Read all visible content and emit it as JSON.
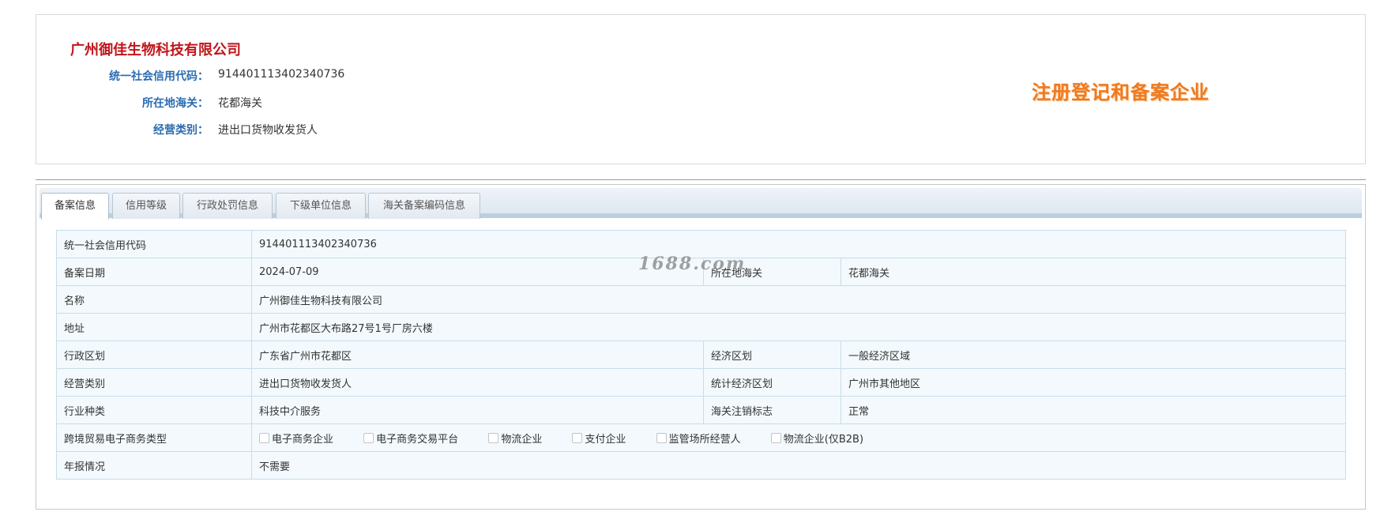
{
  "header": {
    "company_name": "广州御佳生物科技有限公司",
    "rows": [
      {
        "label": "统一社会信用代码：",
        "value": "914401113402340736"
      },
      {
        "label": "所在地海关：",
        "value": "花都海关"
      },
      {
        "label": "经营类别：",
        "value": "进出口货物收发货人"
      }
    ],
    "badge": "注册登记和备案企业"
  },
  "tabs": [
    {
      "label": "备案信息",
      "active": true
    },
    {
      "label": "信用等级",
      "active": false
    },
    {
      "label": "行政处罚信息",
      "active": false
    },
    {
      "label": "下级单位信息",
      "active": false
    },
    {
      "label": "海关备案编码信息",
      "active": false
    }
  ],
  "details": {
    "credit_code": {
      "label": "统一社会信用代码",
      "value": "914401113402340736"
    },
    "record_date": {
      "label": "备案日期",
      "value": "2024-07-09"
    },
    "customs": {
      "label": "所在地海关",
      "value": "花都海关"
    },
    "name": {
      "label": "名称",
      "value": "广州御佳生物科技有限公司"
    },
    "address": {
      "label": "地址",
      "value": "广州市花都区大布路27号1号厂房六楼"
    },
    "admin_region": {
      "label": "行政区划",
      "value": "广东省广州市花都区"
    },
    "econ_region": {
      "label": "经济区划",
      "value": "一般经济区域"
    },
    "business_type": {
      "label": "经营类别",
      "value": "进出口货物收发货人"
    },
    "stat_region": {
      "label": "统计经济区划",
      "value": "广州市其他地区"
    },
    "industry": {
      "label": "行业种类",
      "value": "科技中介服务"
    },
    "cancel_flag": {
      "label": "海关注销标志",
      "value": "正常"
    },
    "ecommerce": {
      "label": "跨境贸易电子商务类型",
      "options": [
        "电子商务企业",
        "电子商务交易平台",
        "物流企业",
        "支付企业",
        "监管场所经营人",
        "物流企业(仅B2B)"
      ]
    },
    "annual_report": {
      "label": "年报情况",
      "value": "不需要"
    }
  },
  "watermark": "1688.com"
}
